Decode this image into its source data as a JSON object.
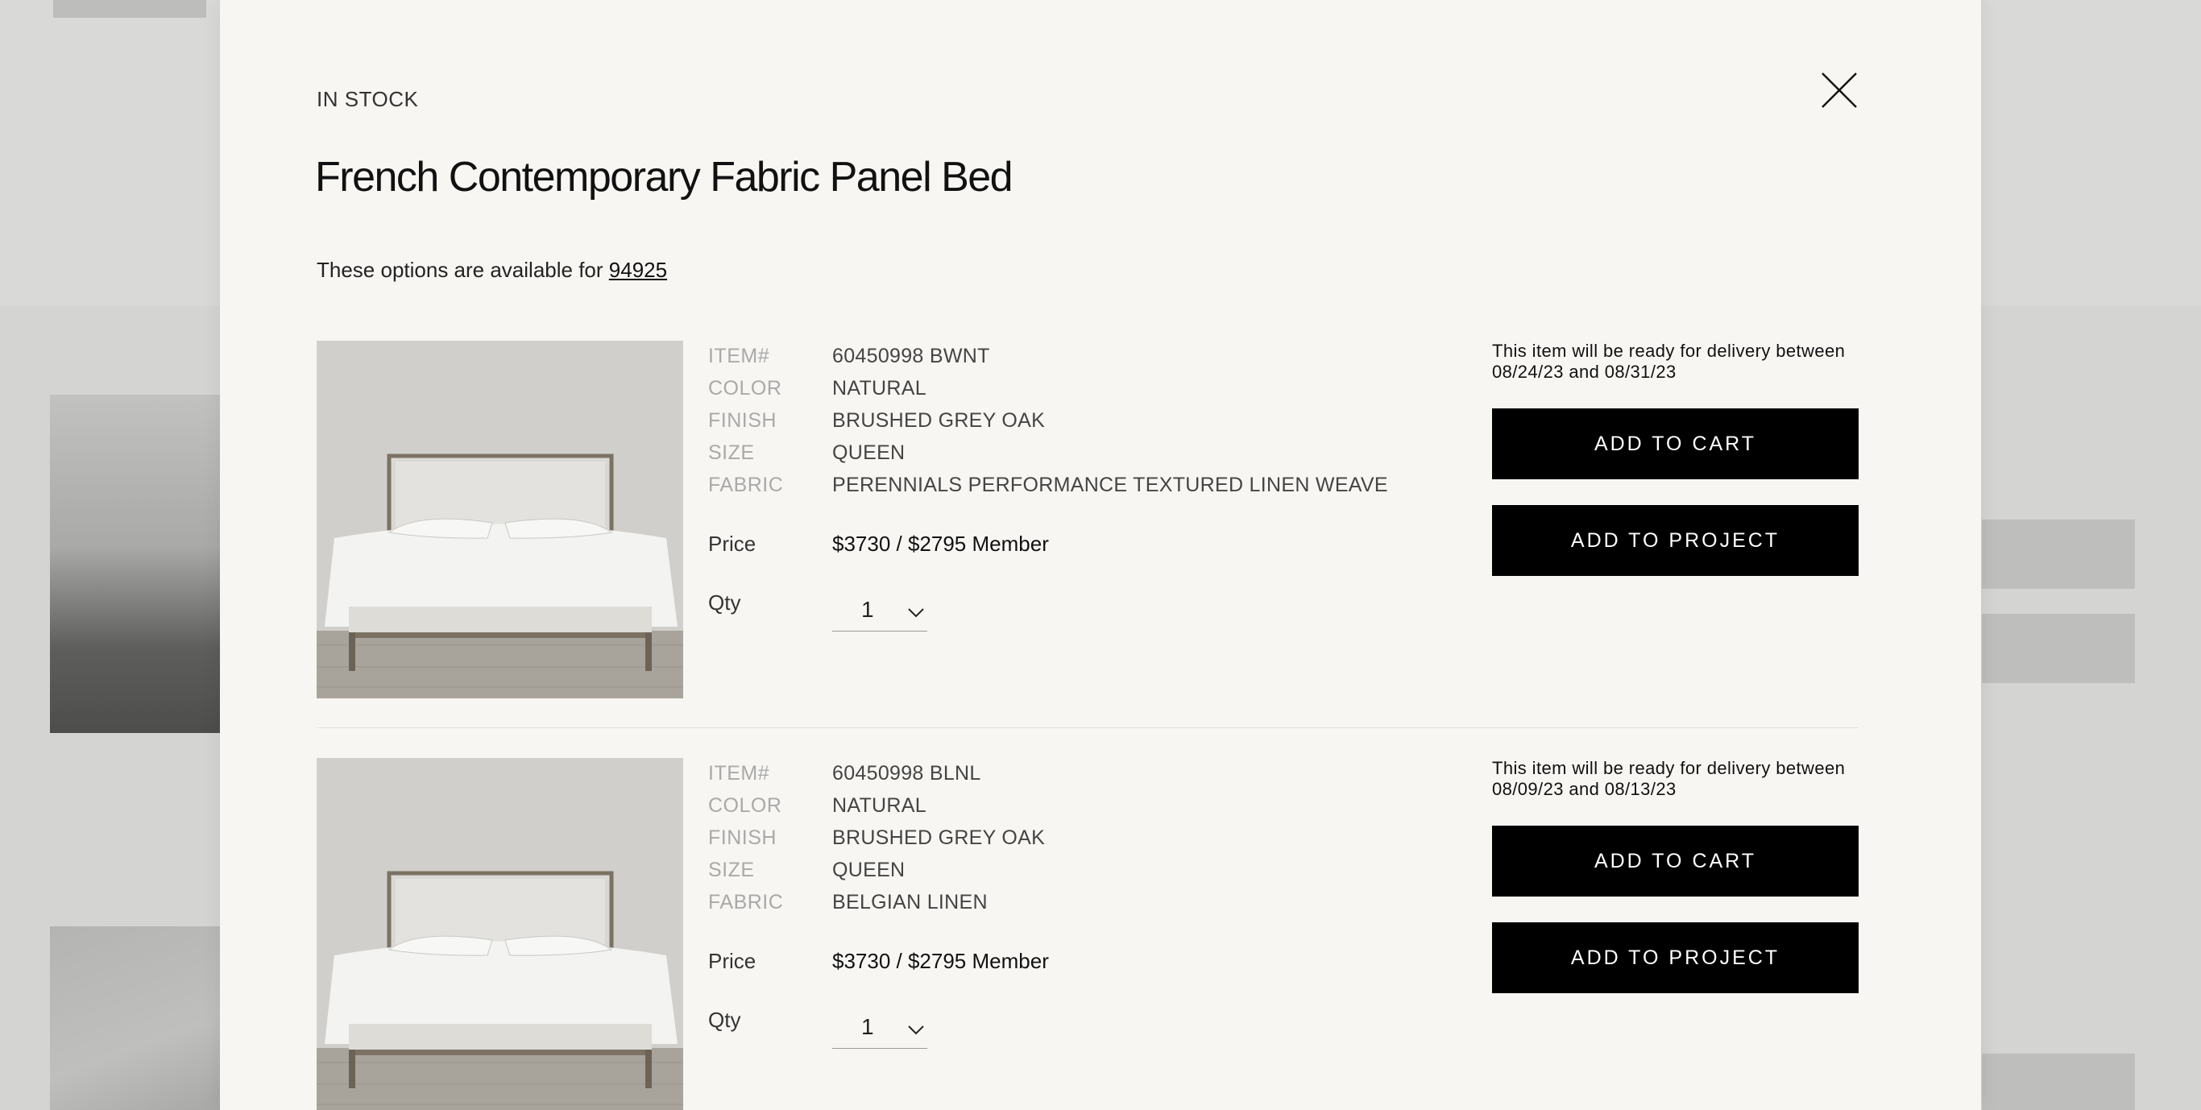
{
  "modal": {
    "stock_status": "IN STOCK",
    "title": "French Contemporary Fabric Panel Bed",
    "availability_text": "These options are available for ",
    "postal_code": "94925",
    "labels": {
      "item": "ITEM#",
      "color": "COLOR",
      "finish": "FINISH",
      "size": "SIZE",
      "fabric": "FABRIC",
      "price": "Price",
      "qty": "Qty"
    },
    "products": [
      {
        "item": "60450998 BWNT",
        "color": "NATURAL",
        "finish": "BRUSHED GREY OAK",
        "size": "QUEEN",
        "fabric": "PERENNIALS PERFORMANCE TEXTURED LINEN WEAVE",
        "price": "$3730 / $2795 Member",
        "qty": "1",
        "delivery": "This item will be ready for delivery between 08/24/23 and 08/31/23",
        "add_to_cart": "ADD TO CART",
        "add_to_project": "ADD TO PROJECT"
      },
      {
        "item": "60450998 BLNL",
        "color": "NATURAL",
        "finish": "BRUSHED GREY OAK",
        "size": "QUEEN",
        "fabric": "BELGIAN LINEN",
        "price": "$3730 / $2795 Member",
        "qty": "1",
        "delivery": "This item will be ready for delivery between 08/09/23 and 08/13/23",
        "add_to_cart": "ADD TO CART",
        "add_to_project": "ADD TO PROJECT"
      }
    ]
  },
  "icons": {
    "close": "close-icon",
    "qty_dropdown": "chevron-down-icon"
  },
  "colors": {
    "modal_background": "#f7f6f3",
    "button_background": "#000000",
    "button_text": "#ffffff",
    "overlay": "#cfcfcd"
  }
}
